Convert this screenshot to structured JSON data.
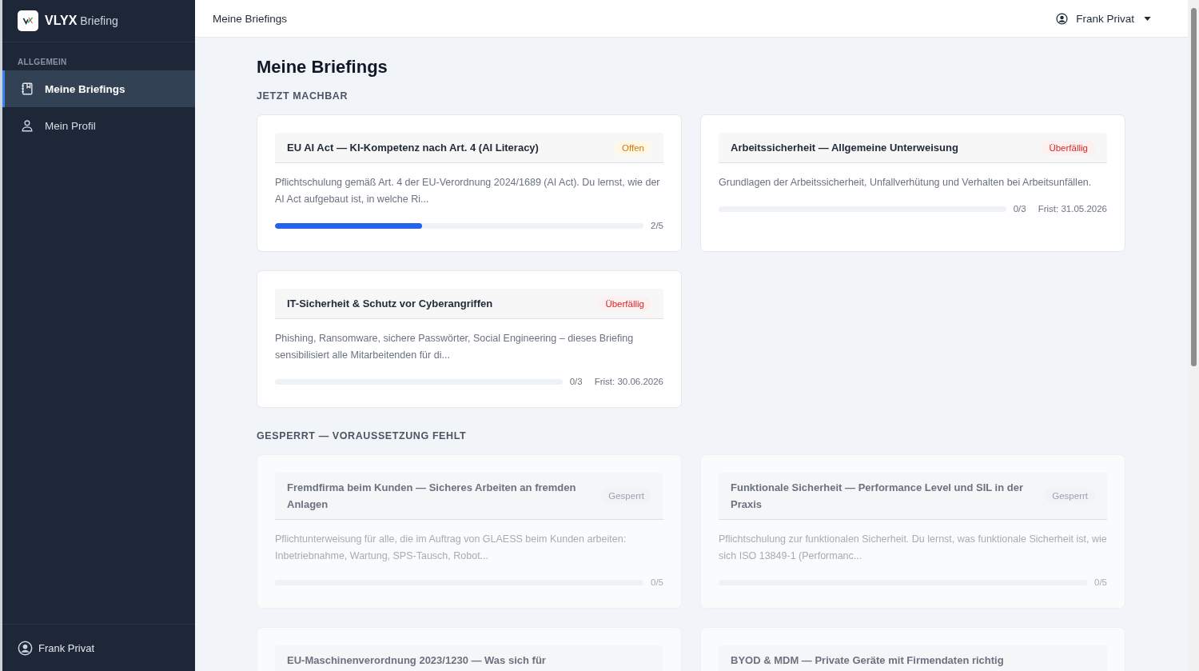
{
  "sidebar": {
    "brand": "VLYX",
    "brand_sub": "Briefing",
    "section": "ALLGEMEIN",
    "items": [
      {
        "label": "Meine Briefings",
        "selected": true
      },
      {
        "label": "Mein Profil",
        "selected": false
      }
    ],
    "footer_user": "Frank Privat"
  },
  "topbar": {
    "title": "Meine Briefings",
    "user": "Frank Privat"
  },
  "page_title": "Meine Briefings",
  "sections": [
    {
      "title": "JETZT MACHBAR",
      "cards": [
        {
          "title": "EU AI Act — KI-Kompetenz nach Art. 4 (AI Literacy)",
          "kind": "open",
          "badge": "Offen",
          "description": "Pflichtschulung gemäß Art. 4 der EU-Verordnung 2024/1689 (AI Act). Du lernst, wie der AI Act aufgebaut ist, in welche Ri...",
          "level": 0.4,
          "count": "2/5"
        },
        {
          "title": "Arbeitssicherheit — Allgemeine Unterweisung",
          "kind": "overdue",
          "badge": "Überfällig",
          "description": "Grundlagen der Arbeitssicherheit, Unfallverhütung und Verhalten bei Arbeitsunfällen.",
          "level": 0,
          "count": "0/3",
          "deadline": "Frist: 31.05.2026"
        },
        {
          "title": "IT-Sicherheit & Schutz vor Cyberangriffen",
          "kind": "overdue",
          "badge": "Überfällig",
          "description": "Phishing, Ransomware, sichere Passwörter, Social Engineering – dieses Briefing sensibilisiert alle Mitarbeitenden für di...",
          "level": 0,
          "count": "0/3",
          "deadline": "Frist: 30.06.2026"
        }
      ]
    },
    {
      "title": "GESPERRT — VORAUSSETZUNG FEHLT",
      "cards": [
        {
          "title": "Fremdfirma beim Kunden — Sicheres Arbeiten an fremden Anlagen",
          "kind": "locked",
          "badge": "Gesperrt",
          "description": "Pflichtunterweisung für alle, die im Auftrag von GLAESS beim Kunden arbeiten: Inbetriebnahme, Wartung, SPS-Tausch, Robot...",
          "level": 0,
          "count": "0/5"
        },
        {
          "title": "Funktionale Sicherheit — Performance Level und SIL in der Praxis",
          "kind": "locked",
          "badge": "Gesperrt",
          "description": "Pflichtschulung zur funktionalen Sicherheit. Du lernst, was funktionale Sicherheit ist, wie sich ISO 13849-1 (Performanc...",
          "level": 0,
          "count": "0/5"
        },
        {
          "title": "EU-Maschinenverordnung 2023/1230 — Was sich für",
          "kind": "locked"
        },
        {
          "title": "BYOD & MDM — Private Geräte mit Firmendaten richtig",
          "kind": "locked"
        }
      ]
    }
  ]
}
